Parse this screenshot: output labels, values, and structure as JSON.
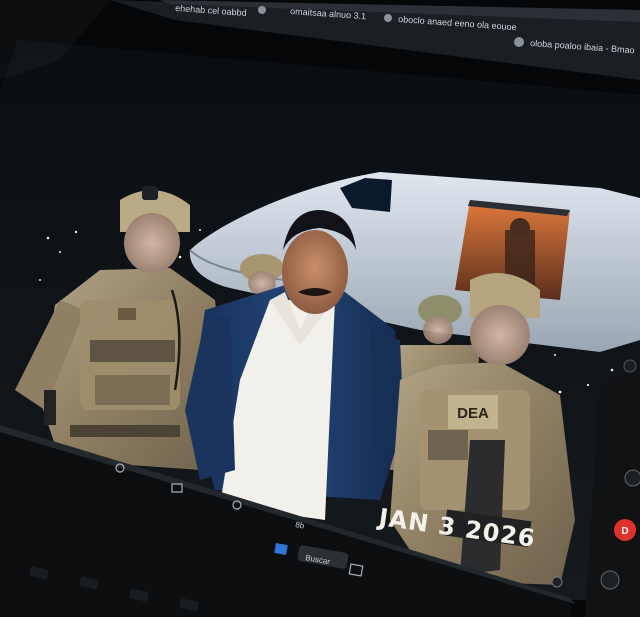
{
  "browser": {
    "tabs": [
      {
        "label": "ehehab cel oabbd"
      },
      {
        "label": "omaitsaa alnuo 3.1"
      },
      {
        "label": "oboclo anaed eeno ola eouoe"
      },
      {
        "label": "oloba poaloo ibaia - Bmao"
      }
    ]
  },
  "photo": {
    "date_stamp": "JAN 3 2026",
    "vest_patch": "DEA"
  },
  "taskbar": {
    "search_label": "Buscar",
    "items": [
      "8b",
      "a",
      "ad"
    ]
  },
  "colors": {
    "plane": "#c9d3de",
    "jacket": "#1d3a66",
    "camo": "#9b8b70",
    "bezel": "#0d0f11",
    "record_button": "#e0302a"
  }
}
